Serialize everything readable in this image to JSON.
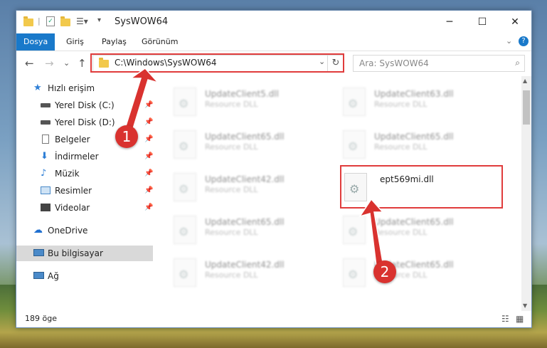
{
  "window": {
    "title": "SysWOW64",
    "minimize": "─",
    "maximize": "☐",
    "close": "✕"
  },
  "ribbon": {
    "tabs": [
      {
        "label": "Dosya",
        "active": true
      },
      {
        "label": "Giriş"
      },
      {
        "label": "Paylaş"
      },
      {
        "label": "Görünüm"
      }
    ],
    "expand": "⌄",
    "help": "?"
  },
  "toolbar": {
    "back": "←",
    "forward": "→",
    "recent": "⌄",
    "up": "↑",
    "address": "C:\\Windows\\SysWOW64",
    "address_dropdown": "⌄",
    "refresh": "↻",
    "search_placeholder": "Ara: SysWOW64",
    "search_icon": "⌕"
  },
  "nav": {
    "quick_access": "Hızlı erişim",
    "items": [
      {
        "label": "Yerel Disk (C:)",
        "icon": "drive-icon",
        "pinned": true
      },
      {
        "label": "Yerel Disk (D:)",
        "icon": "drive-icon",
        "pinned": true
      },
      {
        "label": "Belgeler",
        "icon": "documents-icon",
        "pinned": true
      },
      {
        "label": "İndirmeler",
        "icon": "downloads-icon",
        "pinned": true
      },
      {
        "label": "Müzik",
        "icon": "music-icon",
        "pinned": true
      },
      {
        "label": "Resimler",
        "icon": "pictures-icon",
        "pinned": true
      },
      {
        "label": "Videolar",
        "icon": "videos-icon",
        "pinned": true
      }
    ],
    "onedrive": "OneDrive",
    "this_pc": "Bu bilgisayar",
    "network": "Ağ",
    "pin_glyph": "📌"
  },
  "files": [
    {
      "name": "UpdateClient5.dll",
      "desc": "Resource DLL",
      "blur": true
    },
    {
      "name": "UpdateClient63.dll",
      "desc": "Resource DLL",
      "blur": true
    },
    {
      "name": "UpdateClient65.dll",
      "desc": "Resource DLL",
      "blur": true
    },
    {
      "name": "UpdateClient65.dll",
      "desc": "Resource DLL",
      "blur": true
    },
    {
      "name": "UpdateClient42.dll",
      "desc": "Resource DLL",
      "blur": true
    },
    {
      "name": "ept569mi.dll",
      "desc": "",
      "blur": false
    },
    {
      "name": "UpdateClient65.dll",
      "desc": "Resource DLL",
      "blur": true
    },
    {
      "name": "UpdateClient65.dll",
      "desc": "Resource DLL",
      "blur": true
    },
    {
      "name": "UpdateClient42.dll",
      "desc": "Resource DLL",
      "blur": true
    },
    {
      "name": "UpdateClient65.dll",
      "desc": "Resource DLL",
      "blur": true
    }
  ],
  "status": {
    "count": "189 öge"
  },
  "annotations": {
    "badge1": "1",
    "badge2": "2",
    "highlight_color": "#e03c3c"
  },
  "colors": {
    "ribbon_active": "#1979ca",
    "selection": "#d9d9d9"
  }
}
